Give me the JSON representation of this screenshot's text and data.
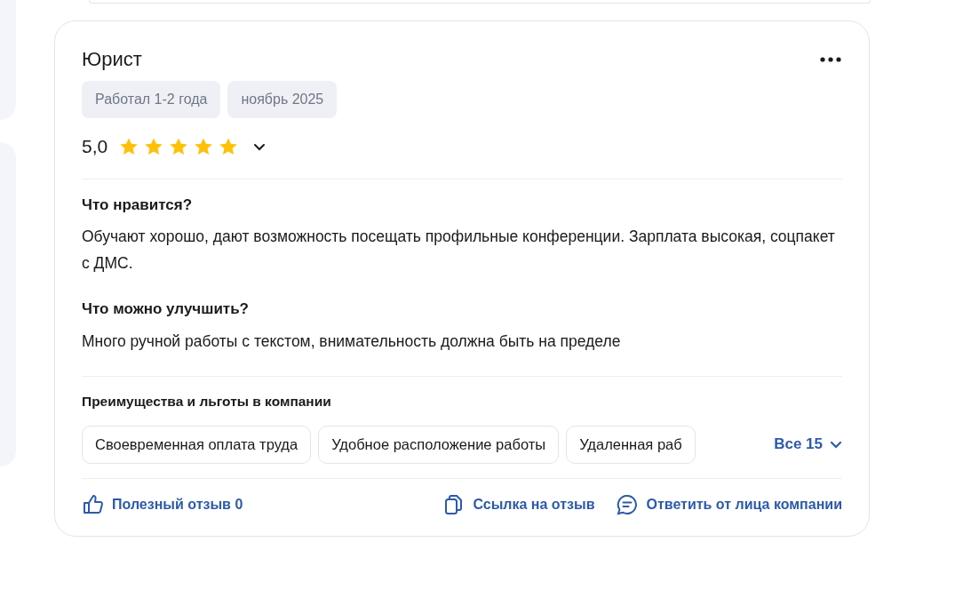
{
  "review": {
    "title": "Юрист",
    "tags": [
      "Работал 1-2 года",
      "ноябрь 2025"
    ],
    "rating": {
      "value": "5,0",
      "stars": 5
    },
    "sections": [
      {
        "heading": "Что нравится?",
        "text": "Обучают хорошо, дают возможность посещать профильные конференции. Зарплата высокая, соцпакет с ДМС."
      },
      {
        "heading": "Что можно улучшить?",
        "text": "Много ручной работы с текстом, внимательность должна быть на пределе"
      }
    ],
    "benefits": {
      "heading": "Преимущества и льготы в компании",
      "items": [
        "Своевременная оплата труда",
        "Удобное расположение работы",
        "Удаленная раб"
      ],
      "all_link": "Все 15"
    },
    "actions": [
      {
        "kind": "like",
        "label": "Полезный отзыв 0"
      },
      {
        "kind": "link",
        "label": "Ссылка на отзыв"
      },
      {
        "kind": "reply",
        "label": "Ответить от лица компании"
      }
    ]
  }
}
